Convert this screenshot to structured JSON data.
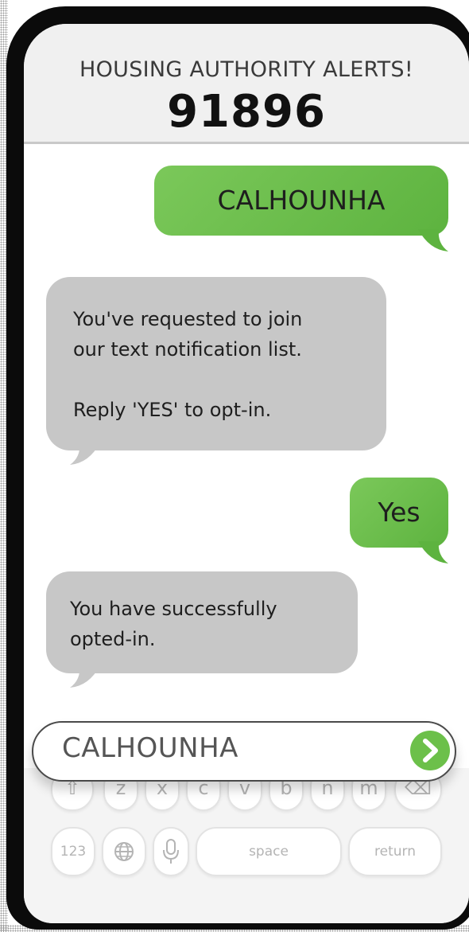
{
  "header": {
    "title": "HOUSING AUTHORITY ALERTS!",
    "number": "91896"
  },
  "messages": [
    {
      "direction": "outgoing",
      "text": "CALHOUNHA"
    },
    {
      "direction": "incoming",
      "lines": [
        "You've requested to join",
        "our text notification list.",
        "",
        "Reply 'YES' to opt-in."
      ]
    },
    {
      "direction": "outgoing",
      "text": "Yes"
    },
    {
      "direction": "incoming",
      "lines": [
        "You have successfully",
        "opted-in."
      ]
    }
  ],
  "input": {
    "value": "CALHOUNHA"
  },
  "keyboard": {
    "row1": [
      "⇧",
      "z",
      "x",
      "c",
      "v",
      "b",
      "n",
      "m",
      "⌫"
    ],
    "row2": {
      "numbers": "123",
      "space": "space",
      "return": "return"
    }
  },
  "colors": {
    "outgoing_bubble": "#6cc04a",
    "incoming_bubble": "#c7c7c7",
    "phone_frame": "#0b0b0b",
    "send_button": "#6cc04a"
  },
  "icons": [
    "shift-icon",
    "backspace-icon",
    "globe-icon",
    "microphone-icon",
    "send-arrow-icon"
  ]
}
